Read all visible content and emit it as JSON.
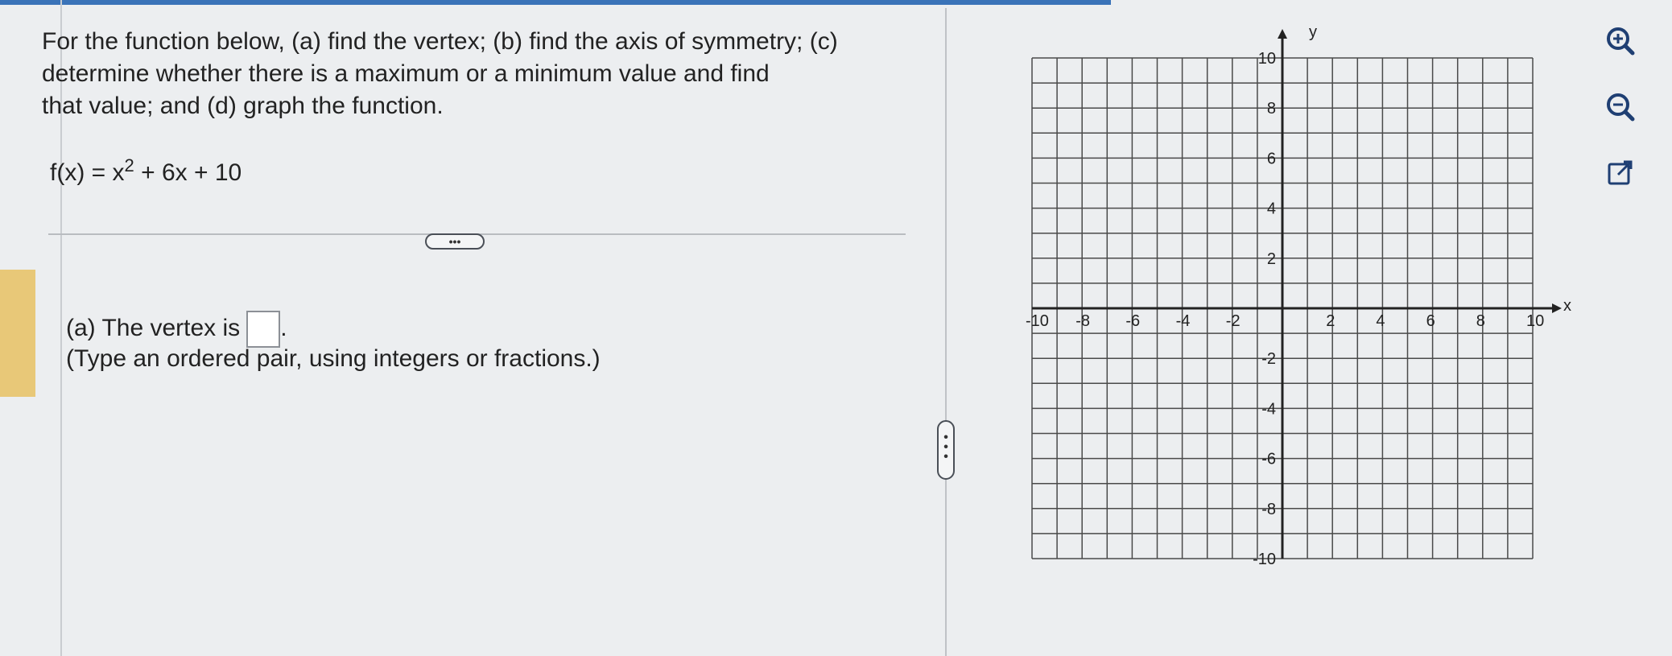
{
  "question": {
    "line1": "For the function below, (a) find the vertex; (b) find the axis of symmetry; (c)",
    "line2": "determine whether there is a maximum or a minimum value and find",
    "line3": "that value; and (d) graph the function."
  },
  "function": {
    "lhs": "f(x) = x",
    "exponent": "2",
    "rest": " + 6x + 10"
  },
  "more_button": "•••",
  "part_a": {
    "prefix": "(a) The vertex is",
    "suffix": ".",
    "answer": "",
    "hint": "(Type an ordered pair, using integers or fractions.)"
  },
  "graph": {
    "x_axis_label": "x",
    "y_axis_label": "y",
    "x_tick_labels": [
      "-10",
      "-8",
      "-6",
      "-4",
      "-2",
      "2",
      "4",
      "6",
      "8",
      "10"
    ],
    "y_tick_labels": [
      "10",
      "8",
      "6",
      "4",
      "2",
      "-2",
      "-4",
      "-6",
      "-8",
      "-10"
    ],
    "x_range": [
      -10,
      10
    ],
    "y_range": [
      -10,
      10
    ],
    "grid_step": 1,
    "grid": true
  },
  "tools": {
    "zoom_in": "zoom-in-icon",
    "zoom_out": "zoom-out-icon",
    "pop_out": "external-link-icon"
  },
  "colors": {
    "accent": "#3a73b8",
    "highlight": "#e8c878",
    "grid": "#4a4a4a"
  }
}
